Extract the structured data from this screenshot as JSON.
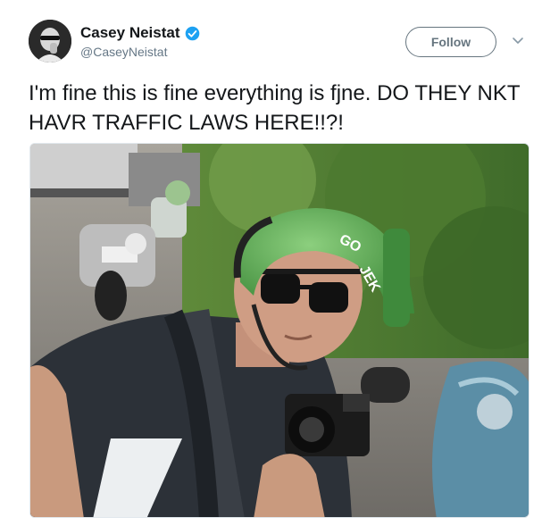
{
  "author": {
    "name": "Casey Neistat",
    "handle": "@CaseyNeistat",
    "verified": true,
    "avatar_icon": "avatar-portrait",
    "verified_icon": "verified-badge-icon"
  },
  "actions": {
    "follow_label": "Follow",
    "more_icon": "chevron-down-icon"
  },
  "tweet": {
    "text": "I'm fine this is fine everything is fjne. DO THEY NKT HAVR TRAFFIC LAWS HERE!!?!"
  },
  "media": {
    "helmet_text_1": "GO",
    "helmet_text_2": "JEK"
  },
  "colors": {
    "twitter_blue": "#1da1f2",
    "text_primary": "#14171a",
    "text_secondary": "#657786",
    "follow_border": "#66757f",
    "helmet_green": "#4fa34a"
  }
}
